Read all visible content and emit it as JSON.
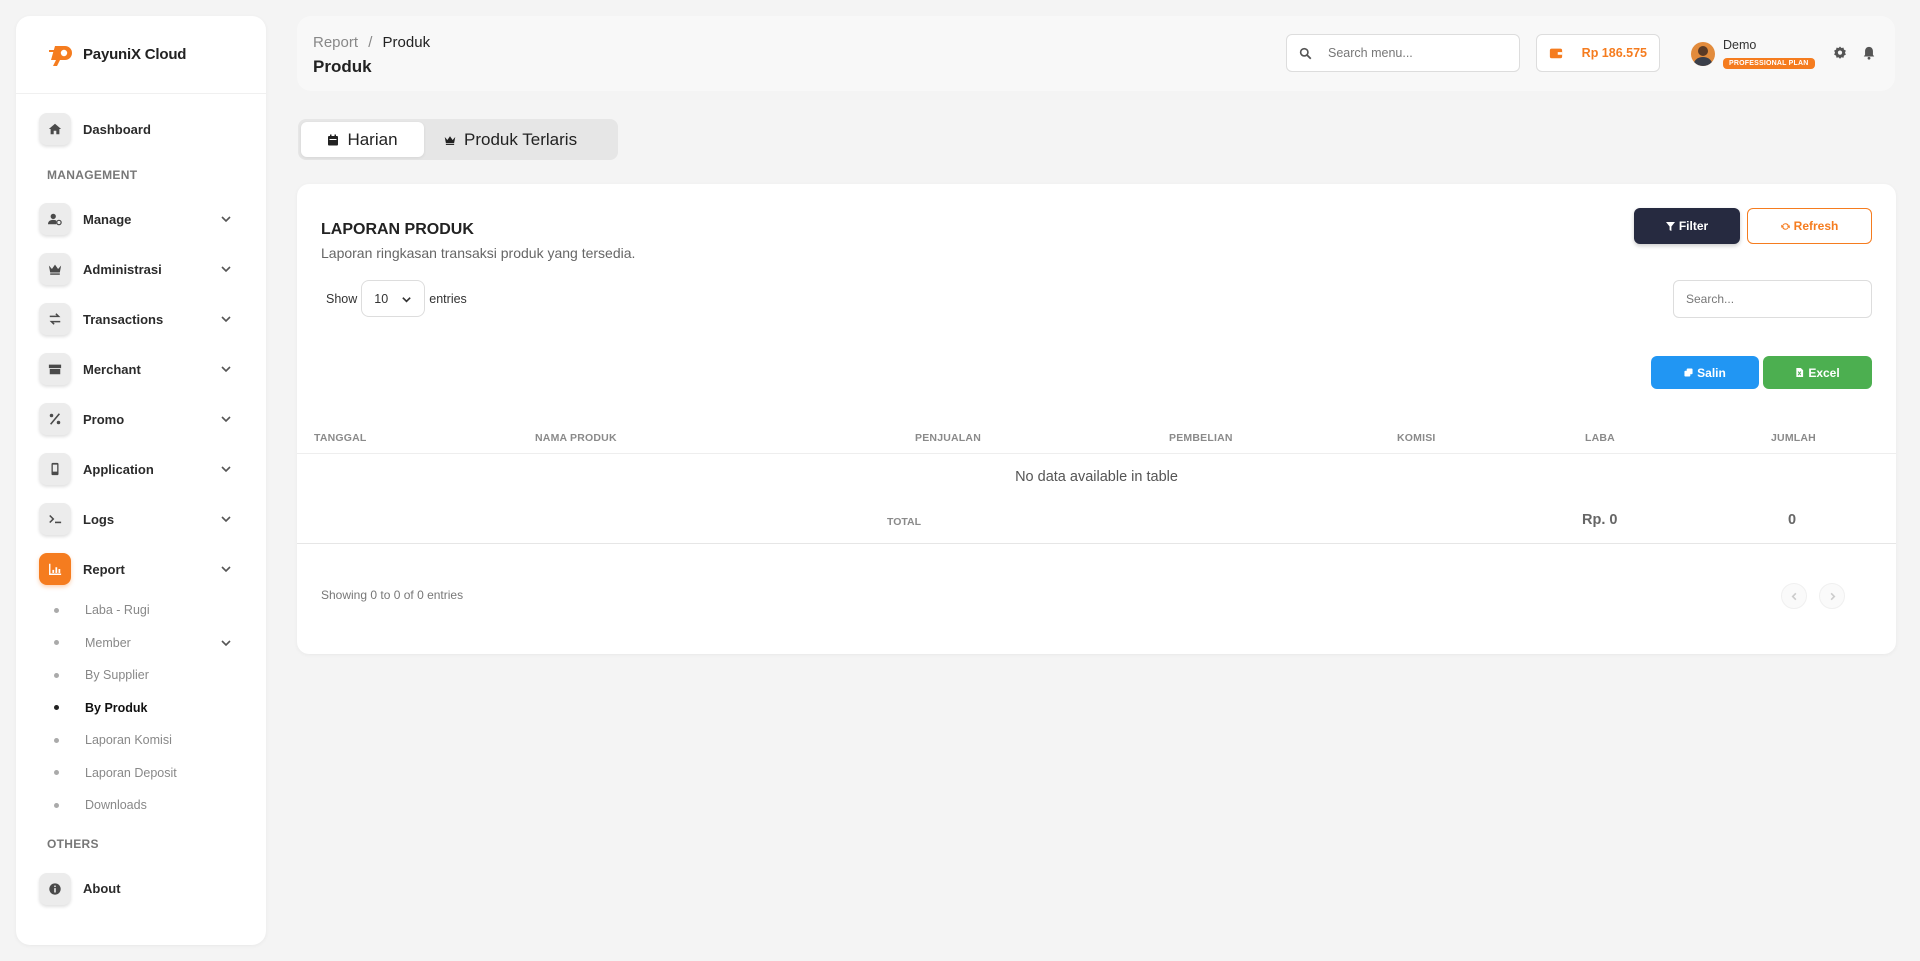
{
  "brand": {
    "name": "PayuniX Cloud",
    "accent": "#f57c1f"
  },
  "sidebar": {
    "dashboard": "Dashboard",
    "section_management": "MANAGEMENT",
    "items": [
      {
        "label": "Manage",
        "icon": "user-gear-icon"
      },
      {
        "label": "Administrasi",
        "icon": "crown-icon"
      },
      {
        "label": "Transactions",
        "icon": "arrows-exchange-icon"
      },
      {
        "label": "Merchant",
        "icon": "store-icon"
      },
      {
        "label": "Promo",
        "icon": "percent-icon"
      },
      {
        "label": "Application",
        "icon": "mobile-icon"
      },
      {
        "label": "Logs",
        "icon": "terminal-icon"
      },
      {
        "label": "Report",
        "icon": "chart-icon"
      }
    ],
    "report_sub": [
      "Laba - Rugi",
      "Member",
      "By Supplier",
      "By Produk",
      "Laporan Komisi",
      "Laporan Deposit",
      "Downloads"
    ],
    "section_others": "OTHERS",
    "about": "About"
  },
  "header": {
    "breadcrumb_parent": "Report",
    "breadcrumb_sep": "/",
    "breadcrumb_current": "Produk",
    "title": "Produk",
    "search_placeholder": "Search menu...",
    "balance": "Rp 186.575",
    "user_name": "Demo",
    "user_plan": "PROFESSIONAL PLAN"
  },
  "tabs": [
    "Harian",
    "Produk Terlaris"
  ],
  "report": {
    "title": "LAPORAN PRODUK",
    "subtitle": "Laporan ringkasan transaksi produk yang tersedia.",
    "filter_label": "Filter",
    "refresh_label": "Refresh",
    "show_label": "Show",
    "entries_value": "10",
    "entries_label": "entries",
    "search_placeholder": "Search...",
    "copy_label": "Salin",
    "excel_label": "Excel",
    "columns": [
      "TANGGAL",
      "NAMA PRODUK",
      "PENJUALAN",
      "PEMBELIAN",
      "KOMISI",
      "LABA",
      "JUMLAH"
    ],
    "empty_text": "No data available in table",
    "total_label": "TOTAL",
    "total_laba": "Rp. 0",
    "total_jumlah": "0",
    "showing": "Showing 0 to 0 of 0 entries"
  }
}
